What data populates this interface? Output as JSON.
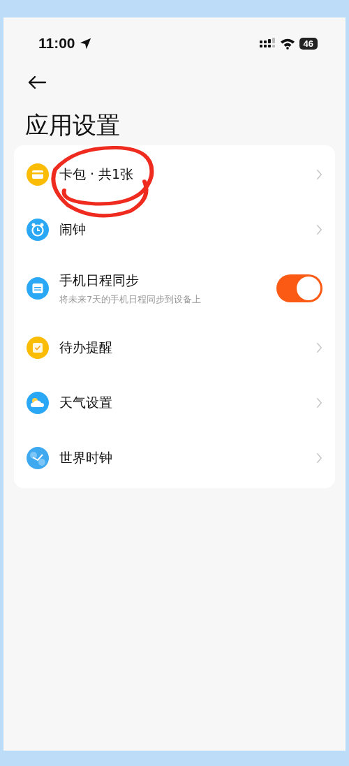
{
  "status_bar": {
    "time": "11:00",
    "battery": "46"
  },
  "header": {
    "title": "应用设置"
  },
  "settings": [
    {
      "kind": "link",
      "label": "卡包 · 共1张",
      "color": "#fbbc05"
    },
    {
      "kind": "link",
      "label": "闹钟",
      "color": "#2ba8f5"
    },
    {
      "kind": "toggle",
      "label": "手机日程同步",
      "subtitle": "将未来7天的手机日程同步到设备上",
      "on": true,
      "color": "#2ba8f5"
    },
    {
      "kind": "link",
      "label": "待办提醒",
      "color": "#fbbc05"
    },
    {
      "kind": "link",
      "label": "天气设置",
      "color": "#2ba8f5"
    },
    {
      "kind": "link",
      "label": "世界时钟",
      "color": "#3fa9f0"
    }
  ]
}
